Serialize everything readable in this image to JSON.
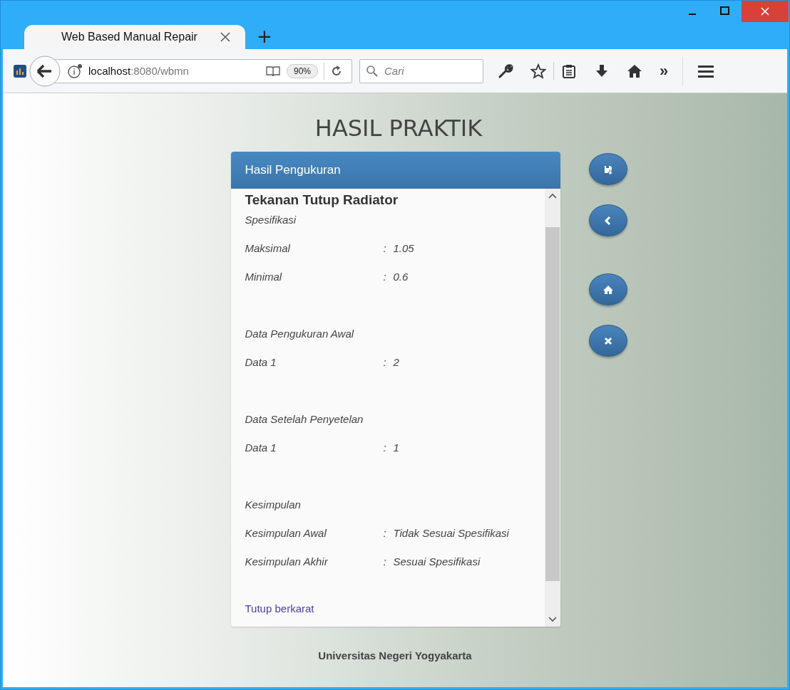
{
  "browser": {
    "tabs": [
      {
        "title": "Web Based Manual Repair",
        "selected": true
      }
    ],
    "new_tab": "+",
    "address": {
      "host": "localhost",
      "path": ":8080/wbmn"
    },
    "zoom": "90%",
    "search": {
      "placeholder": "Cari"
    },
    "overflow": "»"
  },
  "page": {
    "title": "HASIL PRAKTIK",
    "panel": {
      "header": "Hasil Pengukuran",
      "heading": "Tekanan Tutup Radiator",
      "sections": [
        {
          "title": "Spesifikasi",
          "rows": [
            {
              "label": "Maksimal",
              "separator": ":",
              "value": "1.05"
            },
            {
              "label": "Minimal",
              "separator": ":",
              "value": "0.6"
            }
          ]
        },
        {
          "title": "Data Pengukuran Awal",
          "rows": [
            {
              "label": "Data 1",
              "separator": ":",
              "value": "2"
            }
          ]
        },
        {
          "title": "Data Setelah Penyetelan",
          "rows": [
            {
              "label": "Data 1",
              "separator": ":",
              "value": "1"
            }
          ]
        },
        {
          "title": "Kesimpulan",
          "rows": [
            {
              "label": "Kesimpulan Awal",
              "separator": ":",
              "value": "Tidak Sesuai Spesifikasi"
            },
            {
              "label": "Kesimpulan Akhir",
              "separator": ":",
              "value": "Sesuai Spesifikasi"
            }
          ]
        }
      ],
      "link": "Tutup berkarat"
    },
    "actions": [
      {
        "kind": "save"
      },
      {
        "kind": "back"
      },
      {
        "kind": "home"
      },
      {
        "kind": "close"
      }
    ],
    "footer": "Universitas Negeri Yogyakarta"
  }
}
